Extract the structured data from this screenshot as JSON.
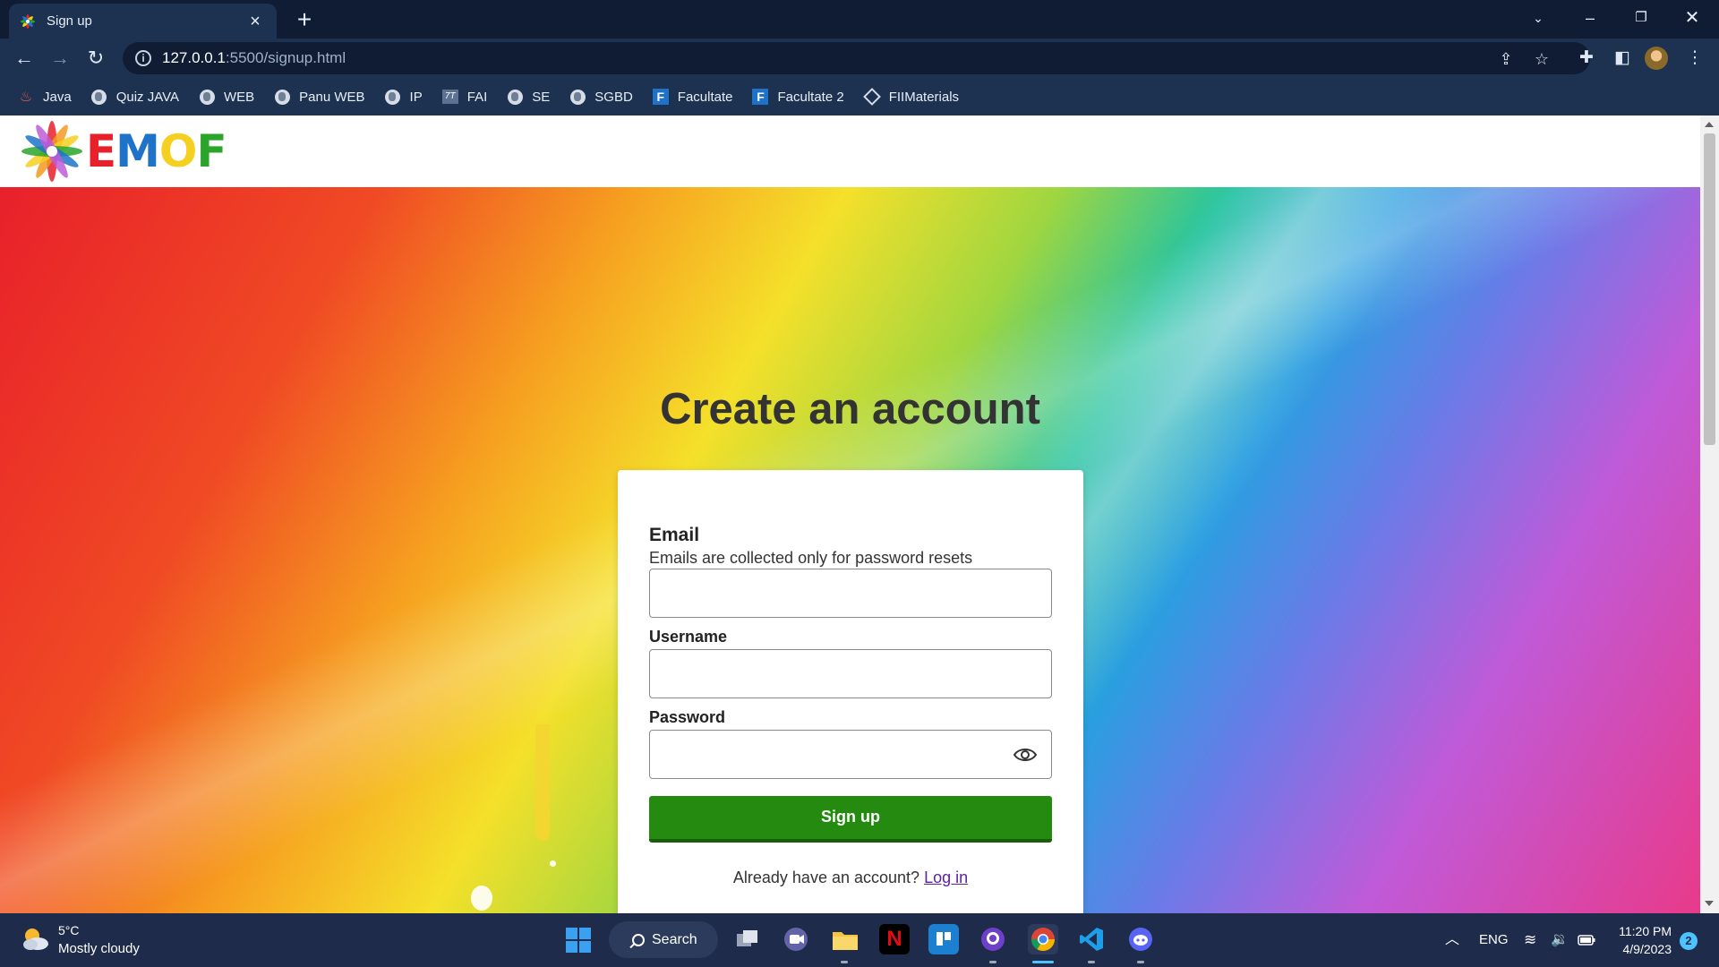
{
  "browser": {
    "tab_title": "Sign up",
    "tab_close": "×",
    "new_tab": "+",
    "url_host": "127.0.0.1",
    "url_rest": ":5500/signup.html",
    "bookmarks": [
      {
        "label": "Java",
        "icon": "java-icon"
      },
      {
        "label": "Quiz JAVA",
        "icon": "globe-icon"
      },
      {
        "label": "WEB",
        "icon": "globe-icon"
      },
      {
        "label": "Panu WEB",
        "icon": "globe-icon"
      },
      {
        "label": "IP",
        "icon": "globe-icon"
      },
      {
        "label": "FAI",
        "icon": "fai-icon"
      },
      {
        "label": "SE",
        "icon": "globe-icon"
      },
      {
        "label": "SGBD",
        "icon": "globe-icon"
      },
      {
        "label": "Facultate",
        "icon": "facultate-icon"
      },
      {
        "label": "Facultate 2",
        "icon": "facultate-icon"
      },
      {
        "label": "FIIMaterials",
        "icon": "fiimaterials-icon"
      }
    ]
  },
  "site": {
    "logo_letters": [
      {
        "char": "E",
        "color": "#e8202a"
      },
      {
        "char": "M",
        "color": "#1e73c8"
      },
      {
        "char": "O",
        "color": "#f5d020"
      },
      {
        "char": "F",
        "color": "#2aa52a"
      }
    ]
  },
  "form": {
    "heading": "Create an account",
    "email_label": "Email",
    "email_hint": "Emails are collected only for password resets",
    "email_value": "",
    "username_label": "Username",
    "username_value": "",
    "password_label": "Password",
    "password_value": "",
    "submit_label": "Sign up",
    "login_prompt": "Already have an account?",
    "login_link": "Log in"
  },
  "taskbar": {
    "weather_temp": "5°C",
    "weather_desc": "Mostly cloudy",
    "search_label": "Search",
    "language": "ENG",
    "time": "11:20 PM",
    "date": "4/9/2023",
    "notification_count": "2"
  },
  "colors": {
    "submit_button": "#258a10",
    "login_link": "#5b21a8",
    "heading": "#333333"
  }
}
